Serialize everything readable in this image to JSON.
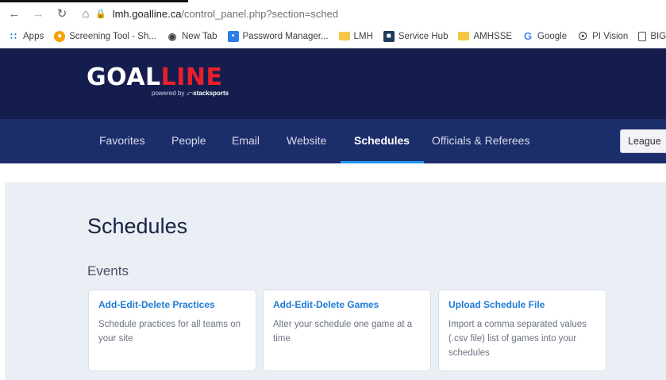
{
  "browser": {
    "url_host": "lmh.goalline.ca",
    "url_path": "/control_panel.php?section=sched",
    "bookmarks": [
      {
        "label": "Apps",
        "icon": "apps-grid-icon"
      },
      {
        "label": "Screening Tool - Sh...",
        "icon": "screening-tool-icon"
      },
      {
        "label": "New Tab",
        "icon": "globe-icon"
      },
      {
        "label": "Password Manager...",
        "icon": "password-manager-icon"
      },
      {
        "label": "LMH",
        "icon": "folder-icon"
      },
      {
        "label": "Service Hub",
        "icon": "service-hub-icon"
      },
      {
        "label": "AMHSSE",
        "icon": "folder-icon"
      },
      {
        "label": "Google",
        "icon": "google-icon"
      },
      {
        "label": "PI Vision",
        "icon": "pi-vision-icon"
      },
      {
        "label": "BIG-IP log",
        "icon": "document-icon"
      }
    ]
  },
  "header": {
    "logo_main": "GOAL",
    "logo_accent": "LINE",
    "logo_powered": "powered by",
    "logo_brand": "stacksports"
  },
  "nav": {
    "items": [
      "Favorites",
      "People",
      "Email",
      "Website",
      "Schedules",
      "Officials & Referees"
    ],
    "active": "Schedules",
    "league_button": "League"
  },
  "main": {
    "title": "Schedules",
    "section": "Events",
    "cards": [
      {
        "title": "Add-Edit-Delete Practices",
        "desc": "Schedule practices for all teams on your site"
      },
      {
        "title": "Add-Edit-Delete Games",
        "desc": "Alter your schedule one game at a time"
      },
      {
        "title": "Upload Schedule File",
        "desc": "Import a comma separated values (.csv file) list of games into your schedules"
      }
    ]
  },
  "colors": {
    "header_bg": "#141d4e",
    "nav_bg": "#1c2d6b",
    "accent_red": "#e8202b",
    "active_underline": "#2196f3",
    "link_blue": "#1e7ad6",
    "content_bg": "#eaeef5"
  }
}
